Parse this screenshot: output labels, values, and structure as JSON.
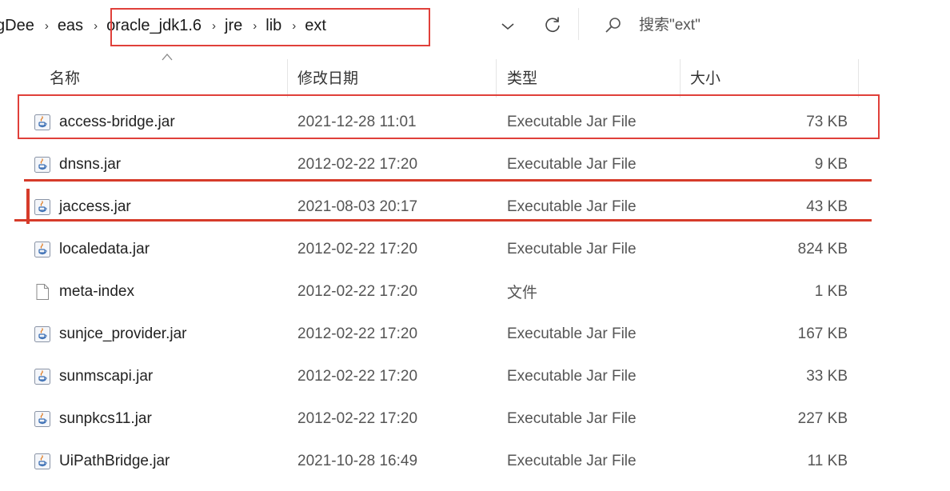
{
  "address_bar": {
    "breadcrumbs": [
      "gDee",
      "eas",
      "oracle_jdk1.6",
      "jre",
      "lib",
      "ext"
    ],
    "separator": "›",
    "search_placeholder": "搜索\"ext\""
  },
  "columns": {
    "name": "名称",
    "date": "修改日期",
    "type": "类型",
    "size": "大小"
  },
  "files": [
    {
      "name": "access-bridge.jar",
      "date": "2021-12-28 11:01",
      "type": "Executable Jar File",
      "size": "73 KB",
      "icon": "jar-file-icon"
    },
    {
      "name": "dnsns.jar",
      "date": "2012-02-22 17:20",
      "type": "Executable Jar File",
      "size": "9 KB",
      "icon": "jar-file-icon"
    },
    {
      "name": "jaccess.jar",
      "date": "2021-08-03 20:17",
      "type": "Executable Jar File",
      "size": "43 KB",
      "icon": "jar-file-icon"
    },
    {
      "name": "localedata.jar",
      "date": "2012-02-22 17:20",
      "type": "Executable Jar File",
      "size": "824 KB",
      "icon": "jar-file-icon"
    },
    {
      "name": "meta-index",
      "date": "2012-02-22 17:20",
      "type": "文件",
      "size": "1 KB",
      "icon": "blank-file-icon"
    },
    {
      "name": "sunjce_provider.jar",
      "date": "2012-02-22 17:20",
      "type": "Executable Jar File",
      "size": "167 KB",
      "icon": "jar-file-icon"
    },
    {
      "name": "sunmscapi.jar",
      "date": "2012-02-22 17:20",
      "type": "Executable Jar File",
      "size": "33 KB",
      "icon": "jar-file-icon"
    },
    {
      "name": "sunpkcs11.jar",
      "date": "2012-02-22 17:20",
      "type": "Executable Jar File",
      "size": "227 KB",
      "icon": "jar-file-icon"
    },
    {
      "name": "UiPathBridge.jar",
      "date": "2021-10-28 16:49",
      "type": "Executable Jar File",
      "size": "11 KB",
      "icon": "jar-file-icon"
    }
  ],
  "colors": {
    "annotation_red": "#e0403a",
    "jar_icon_blue": "#3c6fb4",
    "jar_icon_orange": "#e07a1f"
  }
}
